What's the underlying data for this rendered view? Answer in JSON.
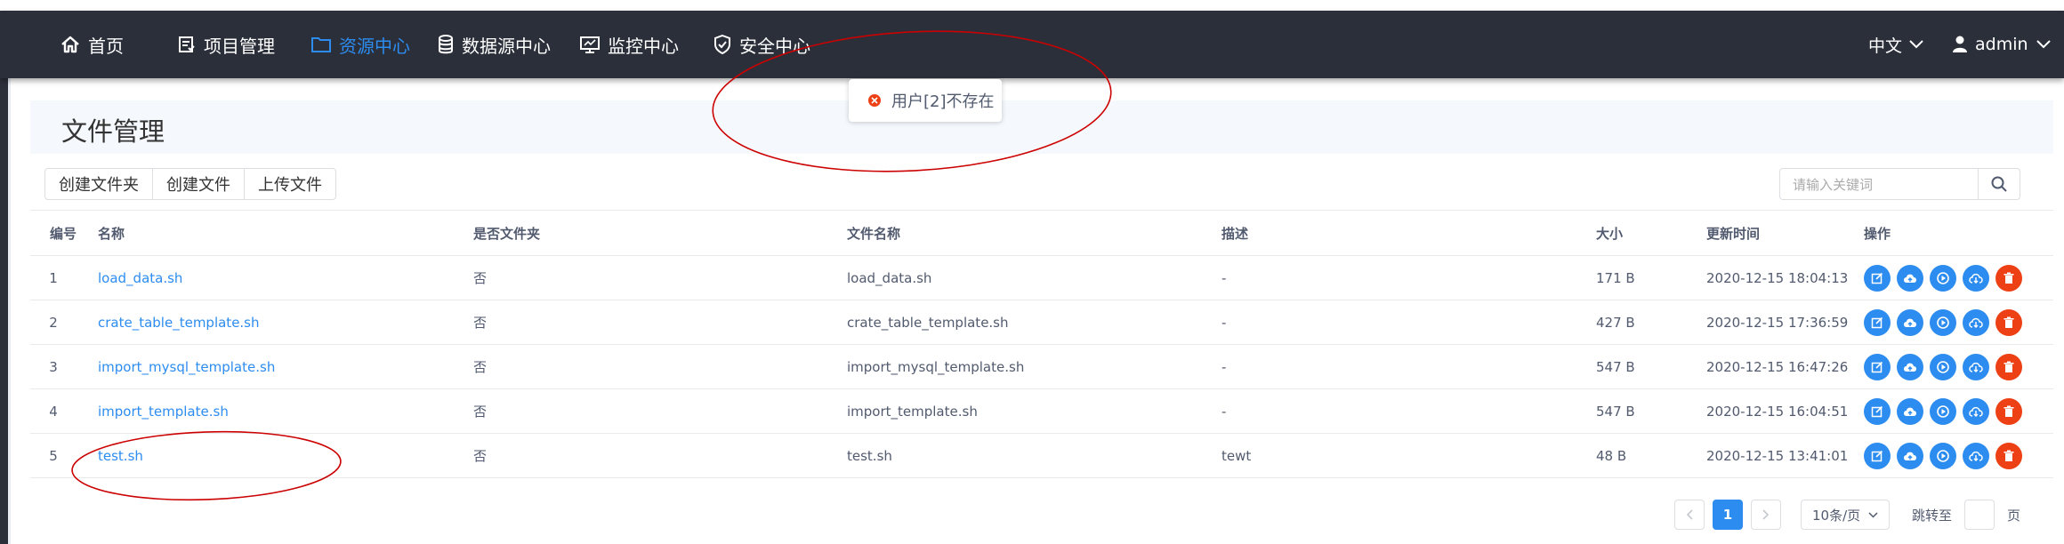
{
  "nav": {
    "items": [
      {
        "label": "首页",
        "icon": "home-icon"
      },
      {
        "label": "项目管理",
        "icon": "project-icon"
      },
      {
        "label": "资源中心",
        "icon": "folder-icon",
        "active": true
      },
      {
        "label": "数据源中心",
        "icon": "database-icon"
      },
      {
        "label": "监控中心",
        "icon": "monitor-icon"
      },
      {
        "label": "安全中心",
        "icon": "shield-icon"
      }
    ],
    "language": "中文",
    "user": "admin"
  },
  "page": {
    "title": "文件管理"
  },
  "toolbar": {
    "create_folder": "创建文件夹",
    "create_file": "创建文件",
    "upload_file": "上传文件"
  },
  "search": {
    "placeholder": "请输入关键词"
  },
  "table": {
    "headers": {
      "id": "编号",
      "name": "名称",
      "is_folder": "是否文件夹",
      "file_name": "文件名称",
      "description": "描述",
      "size": "大小",
      "updated": "更新时间",
      "actions": "操作"
    },
    "rows": [
      {
        "id": "1",
        "name": "load_data.sh",
        "is_folder": "否",
        "file_name": "load_data.sh",
        "description": "-",
        "size": "171 B",
        "updated": "2020-12-15 18:04:13"
      },
      {
        "id": "2",
        "name": "crate_table_template.sh",
        "is_folder": "否",
        "file_name": "crate_table_template.sh",
        "description": "-",
        "size": "427 B",
        "updated": "2020-12-15 17:36:59"
      },
      {
        "id": "3",
        "name": "import_mysql_template.sh",
        "is_folder": "否",
        "file_name": "import_mysql_template.sh",
        "description": "-",
        "size": "547 B",
        "updated": "2020-12-15 16:47:26"
      },
      {
        "id": "4",
        "name": "import_template.sh",
        "is_folder": "否",
        "file_name": "import_template.sh",
        "description": "-",
        "size": "547 B",
        "updated": "2020-12-15 16:04:51"
      },
      {
        "id": "5",
        "name": "test.sh",
        "is_folder": "否",
        "file_name": "test.sh",
        "description": "tewt",
        "size": "48 B",
        "updated": "2020-12-15 13:41:01"
      }
    ]
  },
  "pagination": {
    "current": "1",
    "page_size": "10条/页",
    "jump_label": "跳转至",
    "page_unit": "页"
  },
  "toast": {
    "message": "用户[2]不存在"
  },
  "colors": {
    "nav_bg": "#2b2f3a",
    "accent": "#2d8cf0",
    "danger": "#ed4014",
    "annotation": "#cc0000"
  }
}
